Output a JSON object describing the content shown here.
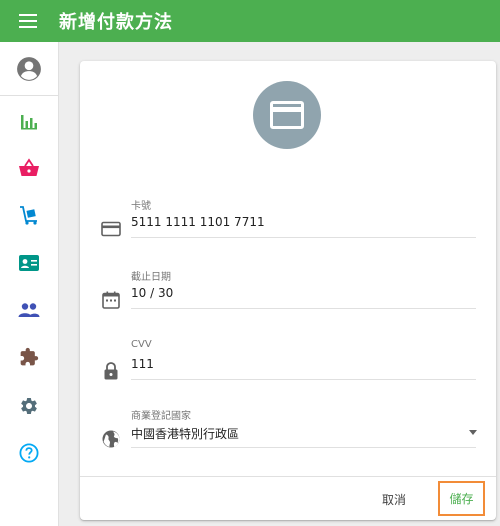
{
  "header": {
    "title": "新增付款方法"
  },
  "sidebar": {
    "items": [
      {
        "icon": "account-circle-icon"
      },
      {
        "icon": "bar-chart-icon"
      },
      {
        "icon": "shopping-basket-icon"
      },
      {
        "icon": "delivery-cart-icon"
      },
      {
        "icon": "contact-card-icon"
      },
      {
        "icon": "people-icon"
      },
      {
        "icon": "puzzle-piece-icon"
      },
      {
        "icon": "settings-icon"
      },
      {
        "icon": "help-icon"
      }
    ]
  },
  "form": {
    "card_number": {
      "label": "卡號",
      "value": "5111 1111 1101 7711"
    },
    "expiry": {
      "label": "截止日期",
      "value": "10 / 30"
    },
    "cvv": {
      "label": "CVV",
      "value": "111"
    },
    "country": {
      "label": "商業登記國家",
      "value": "中國香港特別行政區"
    }
  },
  "actions": {
    "cancel": "取消",
    "save": "儲存"
  },
  "colors": {
    "primary": "#4caf50",
    "highlight": "#f28c38",
    "avatar_bg": "#90a4ae"
  }
}
